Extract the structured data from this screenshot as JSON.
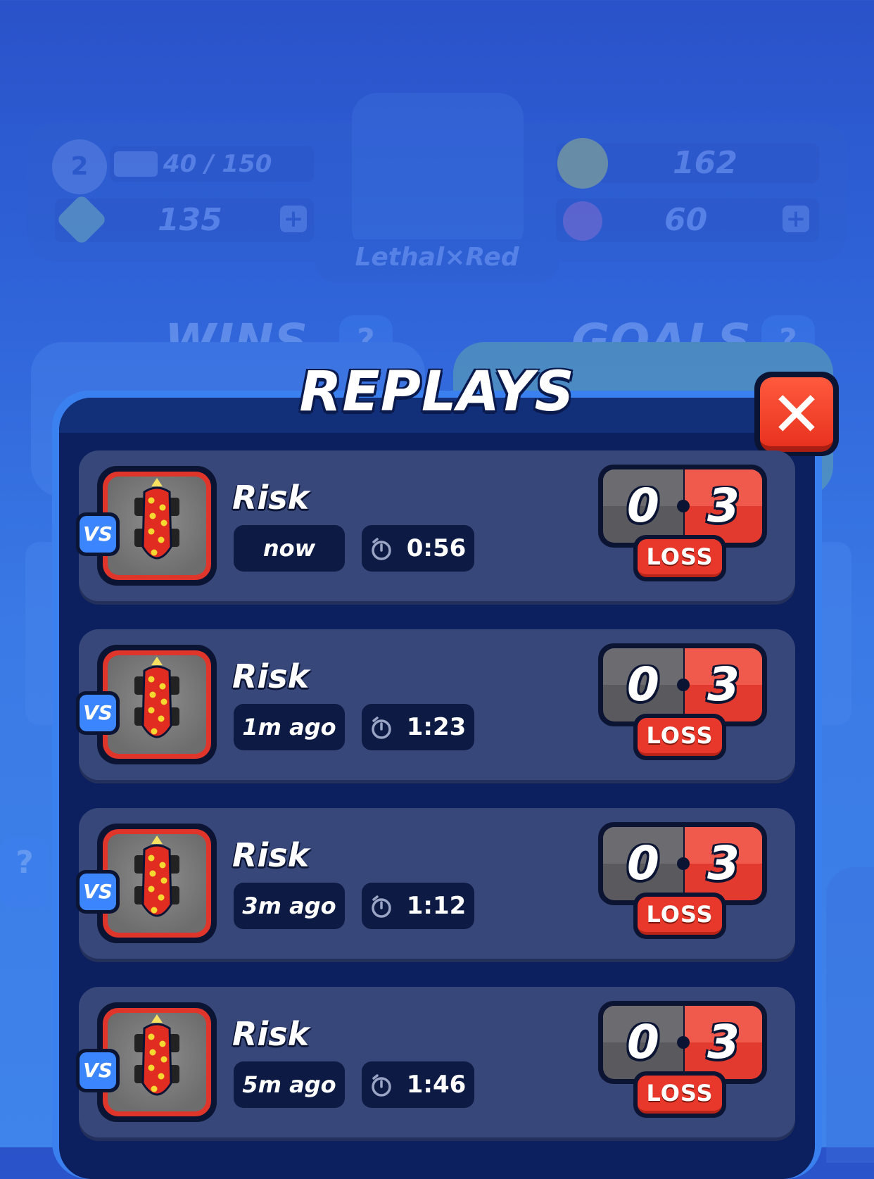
{
  "background": {
    "level": "2",
    "xp": "40 / 150",
    "gems": "135",
    "trophies": "162",
    "tokens": "60",
    "player_name": "Lethal×Red",
    "sections": [
      "WINS",
      "GOALS"
    ],
    "xp_fraction": 0.27
  },
  "modal": {
    "title": "REPLAYS",
    "close_symbol": "✕",
    "replays": [
      {
        "vs": "VS",
        "opponent": "Risk",
        "when": "now",
        "duration": "0:56",
        "score_left": "0",
        "score_right": "3",
        "result": "LOSS"
      },
      {
        "vs": "VS",
        "opponent": "Risk",
        "when": "1m ago",
        "duration": "1:23",
        "score_left": "0",
        "score_right": "3",
        "result": "LOSS"
      },
      {
        "vs": "VS",
        "opponent": "Risk",
        "when": "3m ago",
        "duration": "1:12",
        "score_left": "0",
        "score_right": "3",
        "result": "LOSS"
      },
      {
        "vs": "VS",
        "opponent": "Risk",
        "when": "5m ago",
        "duration": "1:46",
        "score_left": "0",
        "score_right": "3",
        "result": "LOSS"
      }
    ]
  },
  "icons": {
    "timer": "stopwatch-icon",
    "avatar": "red-car-icon",
    "close": "close-icon"
  },
  "colors": {
    "loss_red": "#e8382b",
    "panel_navy": "#0c1f5e",
    "row_bg": "#37477a",
    "vs_blue": "#3b86ff"
  }
}
